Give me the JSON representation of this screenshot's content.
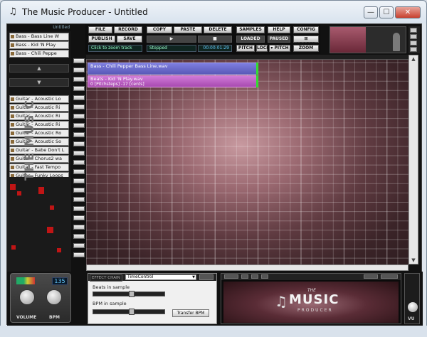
{
  "window": {
    "title": "The Music Producer - Untitled",
    "minimize": "—",
    "maximize": "☐",
    "close": "✕"
  },
  "library": {
    "header": "Untitled",
    "loops": [
      "Bass - Bass Line W",
      "Bass - Kid 'N Play",
      "Bass - Chili Peppe"
    ],
    "guitar_loops": [
      "Guitar - Acoustic Lo",
      "Guitar - Acoustic Ri",
      "Guitar - Acoustic Ri",
      "Guitar - Acoustic Ri",
      "Guitar - Acoustic Ro",
      "Guitar - Acoustic So",
      "Guitar - Babe Don't L",
      "Guitar - Chorus2 wa",
      "Guitar - Fast Tempo",
      "Guitar - Funky Loops"
    ],
    "scroll_up": "▲",
    "scroll_down": "▼",
    "logo": "THE MUSIC"
  },
  "toolbar": {
    "file": "FILE",
    "record": "RECORD",
    "copy": "COPY",
    "paste": "PASTE",
    "delete": "DELETE",
    "samples": "SAMPLES",
    "help": "HELP",
    "config": "CONFIG",
    "publish": "PUBLISH",
    "save": "SAVE",
    "play": "▶",
    "stop": "■",
    "loaded": "LOADED",
    "paused": "PAUSED",
    "looper": "⊞ LOOPER",
    "zoom_hint": "Click to zoom track",
    "status": "Stopped",
    "time": "00:00:01:29",
    "pitch_left": "PITCH ◂",
    "lock": "LOCK",
    "pitch_right": "▾ PITCH",
    "zoom": "ZOOM"
  },
  "tracks": [
    {
      "name": "Bass - Chili Pepper Bass Line.wav",
      "sub": "",
      "color": "#6a6ad0"
    },
    {
      "name": "Beats - Kid 'N Play.wav",
      "sub": "0 [Pitchsteps] -17 [cents]",
      "color": "#c060c8"
    }
  ],
  "mixer": {
    "bpm": "135",
    "volume_label": "VOLUME",
    "bpm_label": "BPM"
  },
  "effects": {
    "tab": "EFFECT CHAIN",
    "selected": "TimeControl",
    "beats_label": "Beats in sample",
    "bpm_label": "BPM in sample",
    "transfer": "Transfer BPM"
  },
  "branding": {
    "the": "THE",
    "music": "MUSIC",
    "producer": "PRODUCER",
    "note": "♫"
  },
  "vu": {
    "label": "VU"
  }
}
